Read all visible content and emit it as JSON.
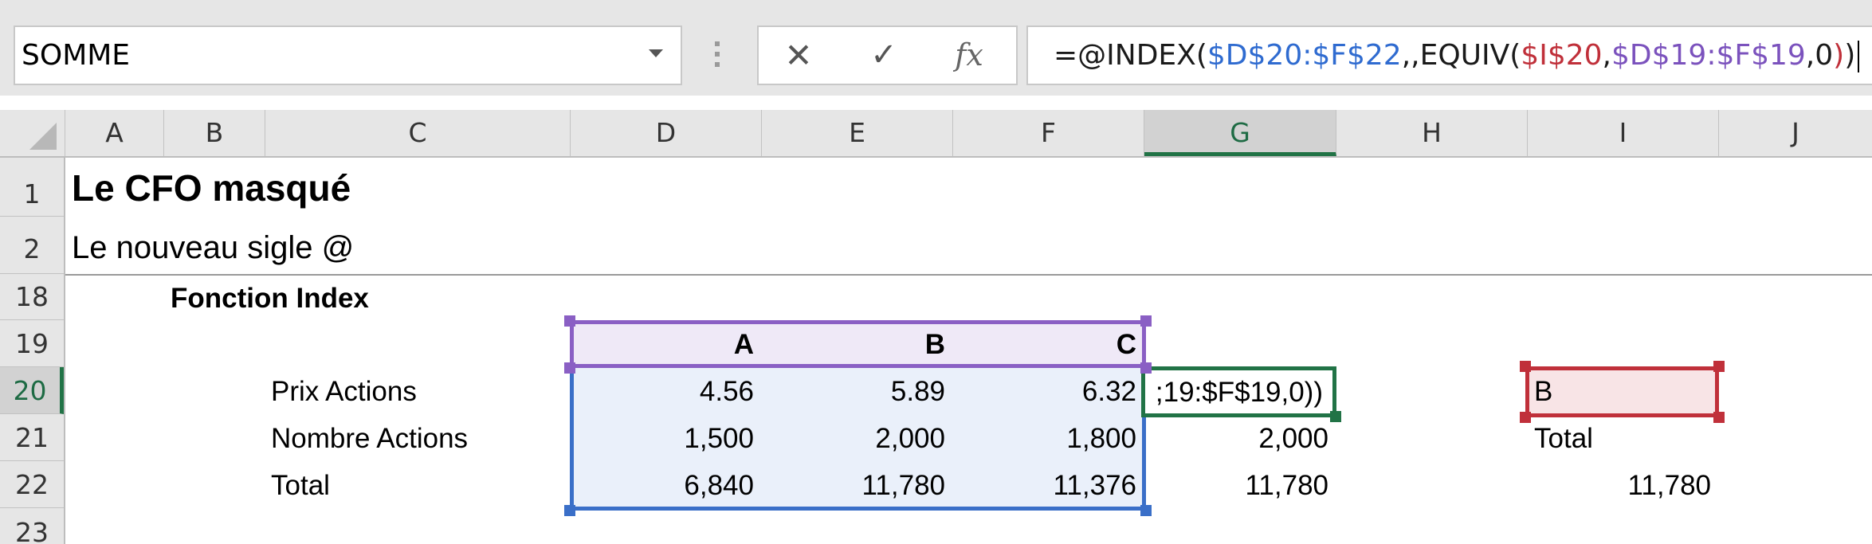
{
  "name_box": {
    "value": "SOMME"
  },
  "formula_bar": {
    "cancel_glyph": "✕",
    "enter_glyph": "✓",
    "fx_label": "fx",
    "parts": {
      "p1": "=@INDEX(",
      "p2": "$D$20:$F$22",
      "p3": ",,EQUIV(",
      "p4": "$I$20",
      "p5": ",",
      "p6": "$D$19:$F$19",
      "p7": ",0",
      "p8": ")",
      "p9": ")"
    }
  },
  "columns": [
    "A",
    "B",
    "C",
    "D",
    "E",
    "F",
    "G",
    "H",
    "I",
    "J"
  ],
  "rows": [
    "1",
    "2",
    "18",
    "19",
    "20",
    "21",
    "22",
    "23"
  ],
  "cells": {
    "A1": "Le CFO masqué",
    "A2": "Le nouveau sigle @",
    "B18": "Fonction Index",
    "D19": "A",
    "E19": "B",
    "F19": "C",
    "C20": "Prix Actions",
    "D20": "4.56",
    "E20": "5.89",
    "F20": "6.32",
    "G20": ";19:$F$19,0))",
    "I20": "B",
    "C21": "Nombre Actions",
    "D21": "1,500",
    "E21": "2,000",
    "F21": "1,800",
    "G21": "2,000",
    "I21": "Total",
    "C22": "Total",
    "D22": "6,840",
    "E22": "11,780",
    "F22": "11,376",
    "G22": "11,780",
    "I22": "11,780"
  },
  "colors": {
    "range_blue": "#3a6fc8",
    "range_purple": "#8a5fc4",
    "range_red": "#c0303a",
    "active_green": "#217346"
  }
}
